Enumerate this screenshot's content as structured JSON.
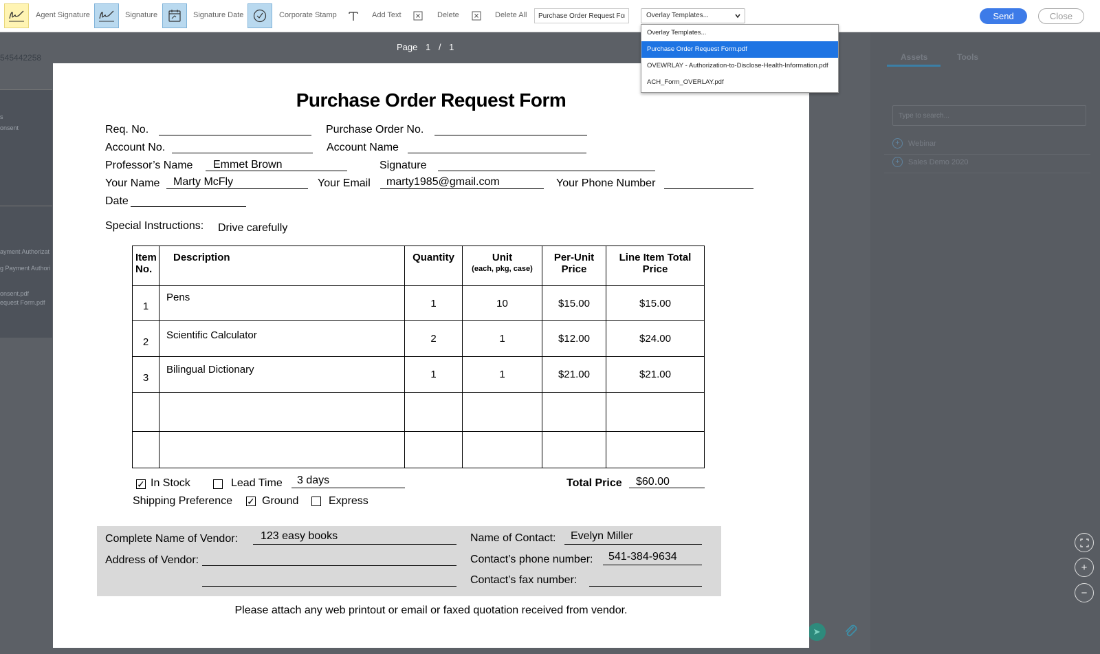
{
  "toolbar": {
    "agent_signature": "Agent Signature",
    "signature": "Signature",
    "signature_date": "Signature Date",
    "corporate_stamp": "Corporate Stamp",
    "add_text": "Add Text",
    "delete": "Delete",
    "delete_all": "Delete All",
    "doc_name_value": "Purchase Order Request For",
    "overlay_select_value": "Overlay Templates...",
    "send": "Send",
    "close": "Close"
  },
  "dropdown": {
    "options": [
      "Overlay Templates...",
      "Purchase Order Request Form.pdf",
      "OVEWRLAY - Authorization-to-Disclose-Health-Information.pdf",
      "ACH_Form_OVERLAY.pdf"
    ],
    "selected_index": 1
  },
  "viewer": {
    "page_label": "Page",
    "page_current": "1",
    "page_sep": "/",
    "page_total": "1",
    "doc_id_partial": "545442258"
  },
  "left_panel": {
    "items": [
      "s",
      "onsent",
      "ayment Authorizat",
      "g Payment Authori",
      "onsent.pdf",
      "equest Form.pdf"
    ]
  },
  "right_panel": {
    "tab_assets": "Assets",
    "tab_tools": "Tools",
    "search_placeholder": "Type to search...",
    "folders": [
      "Webinar",
      "Sales Demo 2020"
    ]
  },
  "form": {
    "title": "Purchase Order Request Form",
    "req_no_label": "Req. No.",
    "po_no_label": "Purchase Order No.",
    "account_no_label": "Account No.",
    "account_name_label": "Account Name",
    "professor_label": "Professor’s Name",
    "professor_value": "Emmet Brown",
    "signature_label": "Signature",
    "your_name_label": "Your Name",
    "your_name_value": "Marty McFly",
    "your_email_label": "Your Email",
    "your_email_value": "marty1985@gmail.com",
    "phone_label": "Your Phone Number",
    "date_label": "Date",
    "special_label": "Special Instructions:",
    "special_value": "Drive carefully",
    "table_headers": {
      "item_no": [
        "Item",
        "No."
      ],
      "description": "Description",
      "quantity": "Quantity",
      "unit": "Unit",
      "unit_sub": "(each, pkg, case)",
      "per_unit": [
        "Per-Unit",
        "Price"
      ],
      "line_total": [
        "Line Item Total",
        "Price"
      ]
    },
    "rows": [
      {
        "item": "1",
        "description": "Pens",
        "quantity": "1",
        "unit": "10",
        "per_unit": "$15.00",
        "total": "$15.00"
      },
      {
        "item": "2",
        "description": "Scientific Calculator",
        "quantity": "2",
        "unit": "1",
        "per_unit": "$12.00",
        "total": "$24.00"
      },
      {
        "item": "3",
        "description": "Bilingual Dictionary",
        "quantity": "1",
        "unit": "1",
        "per_unit": "$21.00",
        "total": "$21.00"
      }
    ],
    "in_stock_label": "In Stock",
    "in_stock_checked": true,
    "lead_time_label": "Lead Time",
    "lead_time_checked": false,
    "lead_time_value": "3 days",
    "total_price_label": "Total Price",
    "total_price_value": "$60.00",
    "shipping_label": "Shipping Preference",
    "ground_label": "Ground",
    "ground_checked": true,
    "express_label": "Express",
    "express_checked": false,
    "vendor_name_label": "Complete Name of Vendor:",
    "vendor_name_value": "123 easy books",
    "contact_name_label": "Name of Contact:",
    "contact_name_value": "Evelyn Miller",
    "vendor_address_label": "Address of Vendor:",
    "contact_phone_label": "Contact’s phone number:",
    "contact_phone_value": "541-384-9634",
    "contact_fax_label": "Contact’s fax number:",
    "footer": "Please attach any web printout or email or faxed quotation received from vendor."
  },
  "check_mark": "✓"
}
